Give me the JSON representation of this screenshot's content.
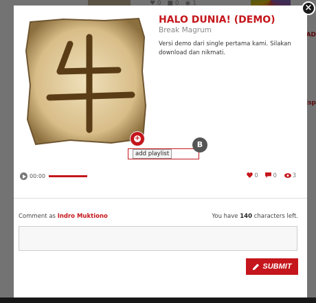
{
  "background": {
    "stats": [
      "♥ 0",
      "■ 0",
      "◉ 1"
    ],
    "side_fragments": [
      "AD",
      "jsp"
    ]
  },
  "track": {
    "title": "HALO DUNIA! (DEMO)",
    "artist": "Break Magrum",
    "description": "Versi demo dari single pertama kami. Silakan download dan nikmati."
  },
  "playlist": {
    "tooltip": "add playlist",
    "badge": "B"
  },
  "player": {
    "time": "00:00",
    "progress": 1.0
  },
  "stats": {
    "likes": "0",
    "comments": "0",
    "views": "3"
  },
  "comment": {
    "label": "Comment as",
    "user": "Indro Muktiono",
    "chars_prefix": "You have",
    "chars_count": "140",
    "chars_suffix": "characters left.",
    "placeholder": ""
  },
  "submit_label": "SUBMIT",
  "colors": {
    "accent": "#c4161c",
    "overlay": "rgba(0,0,0,0.55)"
  }
}
